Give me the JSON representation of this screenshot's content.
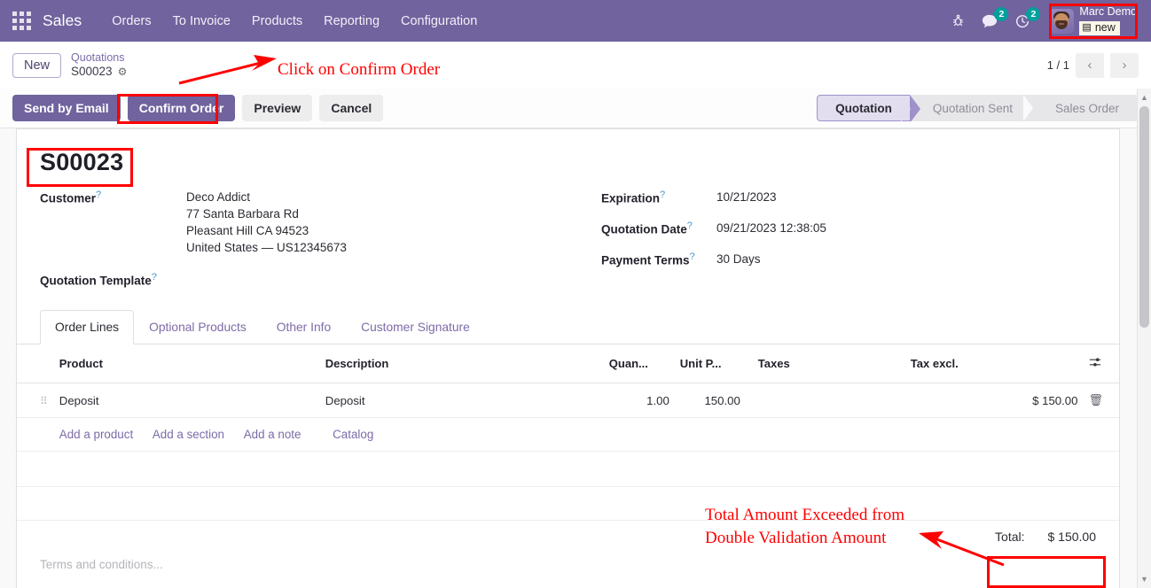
{
  "navbar": {
    "apps_icon": "apps-grid-icon",
    "brand": "Sales",
    "menu": [
      {
        "label": "Orders"
      },
      {
        "label": "To Invoice"
      },
      {
        "label": "Products"
      },
      {
        "label": "Reporting"
      },
      {
        "label": "Configuration"
      }
    ],
    "icons": {
      "bug": "bug-icon",
      "messages": "chat-icon",
      "messages_count": "2",
      "activities": "clock-icon",
      "activities_count": "2"
    },
    "user": {
      "name": "Marc Demo",
      "database": "new",
      "db_icon": "database-icon",
      "avatar": "user-avatar"
    }
  },
  "control_panel": {
    "new_button": "New",
    "breadcrumb_parent": "Quotations",
    "breadcrumb_current": "S00023",
    "gear_icon": "gear-icon",
    "pager": "1 / 1",
    "prev_icon": "chevron-left-icon",
    "next_icon": "chevron-right-icon"
  },
  "actions": {
    "buttons": [
      {
        "label": "Send by Email",
        "type": "primary"
      },
      {
        "label": "Confirm Order",
        "type": "primary"
      },
      {
        "label": "Preview",
        "type": "secondary"
      },
      {
        "label": "Cancel",
        "type": "secondary"
      }
    ],
    "status": [
      {
        "label": "Quotation",
        "active": true
      },
      {
        "label": "Quotation Sent",
        "active": false
      },
      {
        "label": "Sales Order",
        "active": false
      }
    ]
  },
  "record": {
    "title": "S00023",
    "customer_label": "Customer",
    "customer_name": "Deco Addict",
    "customer_address_1": "77 Santa Barbara Rd",
    "customer_address_2": "Pleasant Hill CA 94523",
    "customer_address_3": "United States — US12345673",
    "quotation_template_label": "Quotation Template",
    "quotation_template_value": "",
    "expiration_label": "Expiration",
    "expiration_value": "10/21/2023",
    "quotation_date_label": "Quotation Date",
    "quotation_date_value": "09/21/2023 12:38:05",
    "payment_terms_label": "Payment Terms",
    "payment_terms_value": "30 Days"
  },
  "notebook": {
    "tabs": [
      {
        "label": "Order Lines",
        "active": true
      },
      {
        "label": "Optional Products",
        "active": false
      },
      {
        "label": "Other Info",
        "active": false
      },
      {
        "label": "Customer Signature",
        "active": false
      }
    ]
  },
  "order_lines": {
    "columns": [
      "Product",
      "Description",
      "Quan...",
      "Unit P...",
      "Taxes",
      "Tax excl."
    ],
    "optional_columns_icon": "sliders-icon",
    "rows": [
      {
        "drag_handle": "drag-handle-icon",
        "product": "Deposit",
        "description": "Deposit",
        "quantity": "1.00",
        "unit_price": "150.00",
        "taxes": "",
        "subtotal": "$ 150.00",
        "delete_icon": "trash-icon"
      }
    ],
    "add_links": [
      "Add a product",
      "Add a section",
      "Add a note"
    ],
    "catalog_link": "Catalog"
  },
  "totals": {
    "label": "Total:",
    "value": "$ 150.00"
  },
  "terms_placeholder": "Terms and conditions...",
  "annotations": [
    {
      "text": "Click on Confirm Order"
    },
    {
      "text": "Total Amount Exceeded from"
    },
    {
      "text": "Double Validation Amount"
    }
  ],
  "colors": {
    "brand_purple": "#71639e",
    "annotation_red": "#ff0000",
    "badge_teal": "#00a09d",
    "link_purple": "#7d6ba8"
  }
}
